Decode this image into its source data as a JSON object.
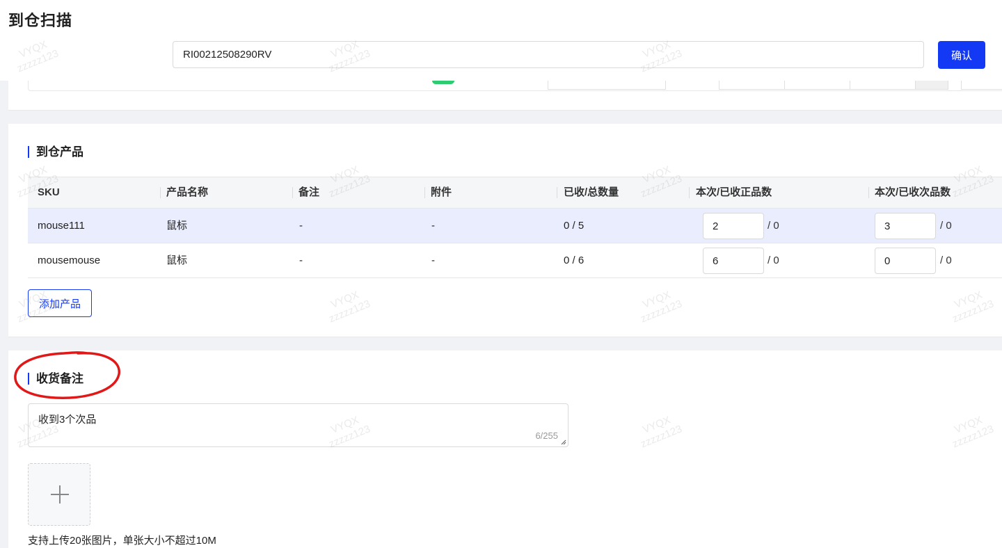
{
  "header": {
    "title": "到仓扫描",
    "scan_value": "RI00212508290RV",
    "confirm_label": "确认"
  },
  "products": {
    "section_title": "到仓产品",
    "columns": [
      "SKU",
      "产品名称",
      "备注",
      "附件",
      "已收/总数量",
      "本次/已收正品数",
      "本次/已收次品数"
    ],
    "rows": [
      {
        "sku": "mouse111",
        "name": "鼠标",
        "remark": "-",
        "attachment": "-",
        "received_total": "0 / 5",
        "good_qty": "2",
        "good_received": "/ 0",
        "defect_qty": "3",
        "defect_received": "/ 0"
      },
      {
        "sku": "mousemouse",
        "name": "鼠标",
        "remark": "-",
        "attachment": "-",
        "received_total": "0 / 6",
        "good_qty": "6",
        "good_received": "/ 0",
        "defect_qty": "0",
        "defect_received": "/ 0"
      }
    ],
    "add_label": "添加产品"
  },
  "remark": {
    "section_title": "收货备注",
    "text": "收到3个次品",
    "char_count": "6/255",
    "upload_hint": "支持上传20张图片，单张大小不超过10M"
  },
  "watermark": {
    "line1": "VYQX",
    "line2": "zzzzz123"
  },
  "colors": {
    "primary": "#1439f5",
    "annotation": "#e01818",
    "active_row": "#e9edfd"
  }
}
